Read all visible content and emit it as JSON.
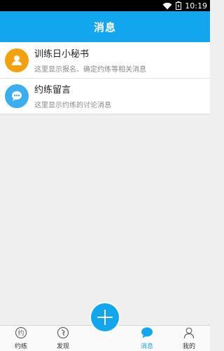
{
  "status_bar": {
    "time": "10:19",
    "icons": [
      "wifi-icon",
      "battery-charging-icon"
    ]
  },
  "header": {
    "title": "消息"
  },
  "messages": [
    {
      "title": "训练日小秘书",
      "subtitle": "这里显示报名、确定约练等相关消息",
      "icon": "person-icon",
      "color": "#f5a10e"
    },
    {
      "title": "约练留言",
      "subtitle": "这里显示约练的讨论消息",
      "icon": "chat-bubble-icon",
      "color": "#3aaef0"
    }
  ],
  "nav": {
    "items": [
      {
        "label": "约练",
        "icon": "yue-practice-icon",
        "active": false
      },
      {
        "label": "发现",
        "icon": "discover-compass-icon",
        "active": false
      },
      {
        "label": "消息",
        "icon": "message-bubble-icon",
        "active": true
      },
      {
        "label": "我的",
        "icon": "profile-person-icon",
        "active": false
      }
    ],
    "fab_icon": "plus-icon"
  },
  "colors": {
    "primary": "#12a6ee",
    "background": "#efefef",
    "status_bar": "#000000"
  }
}
